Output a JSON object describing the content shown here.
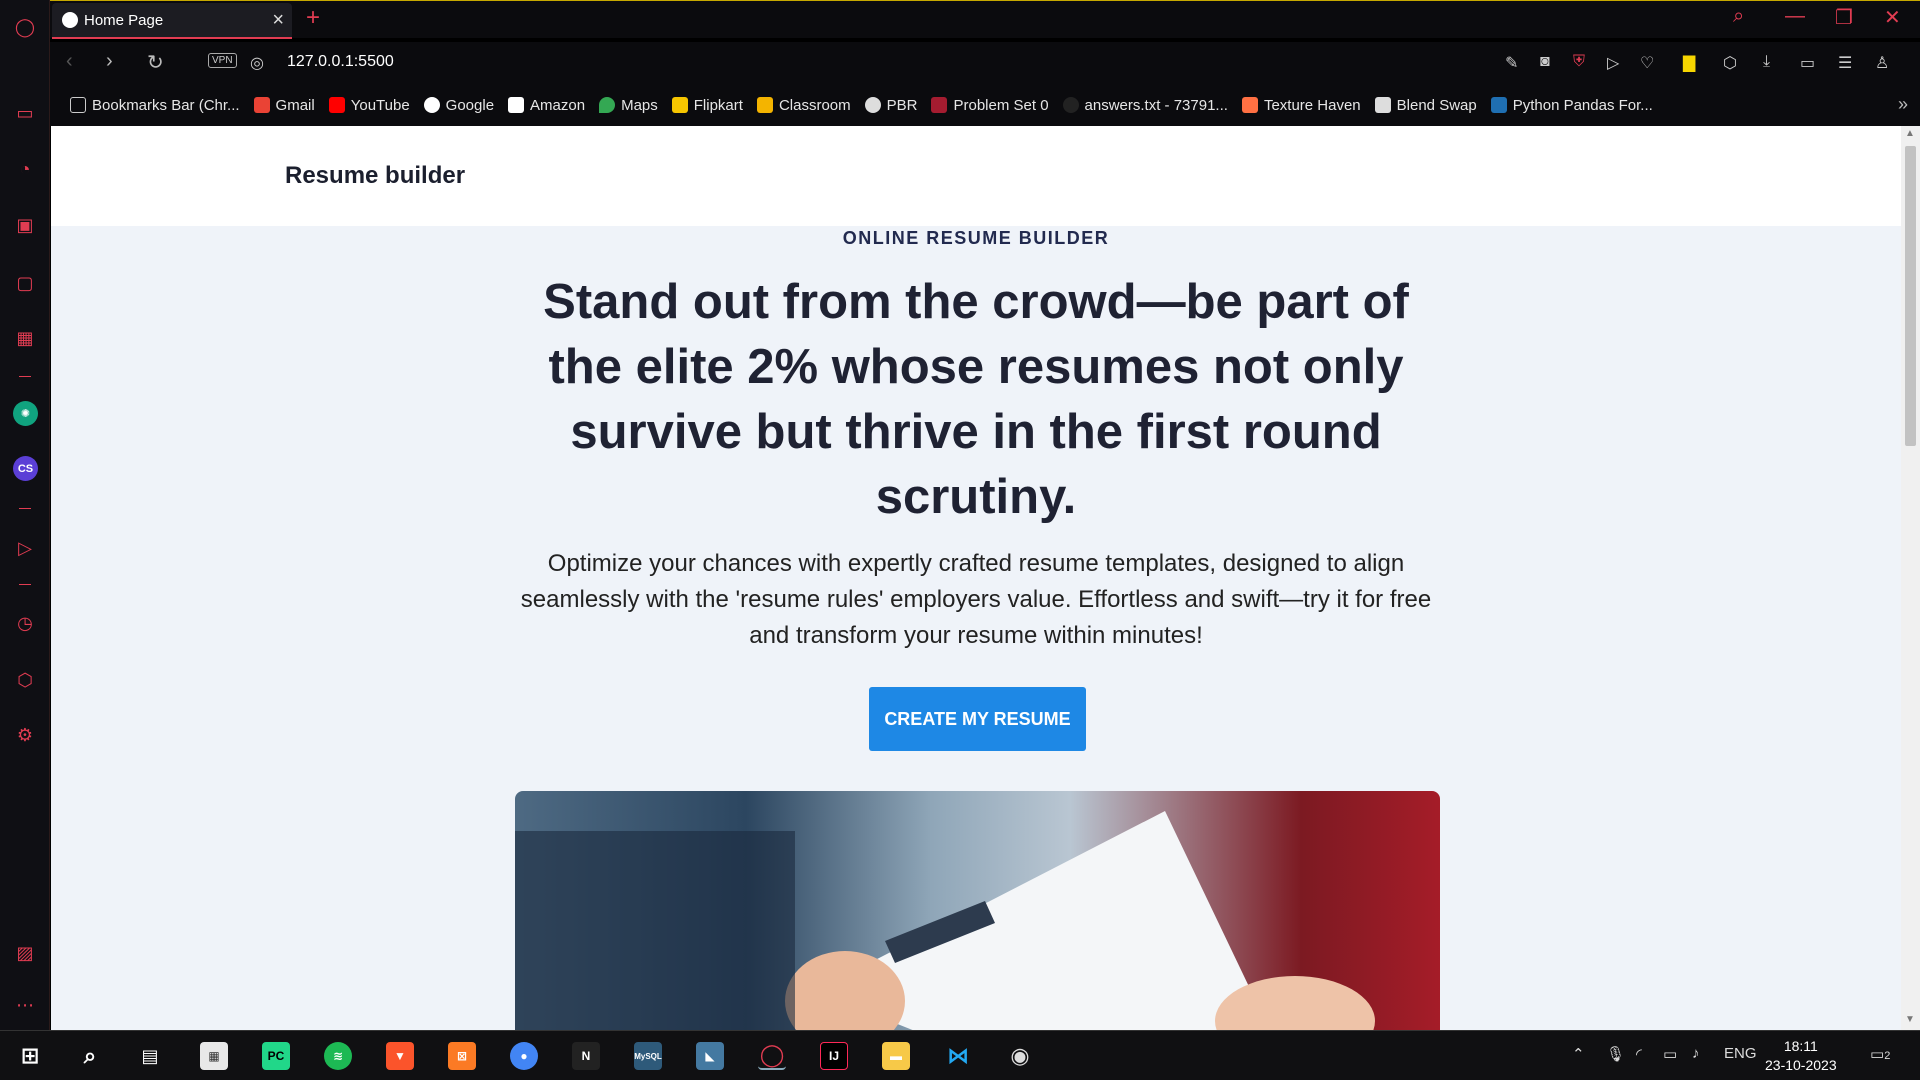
{
  "browser": {
    "tab_title": "Home Page",
    "url": "127.0.0.1:5500",
    "vpn_label": "VPN",
    "bookmarks": [
      {
        "label": "Bookmarks Bar (Chr...",
        "color": "#cccccc"
      },
      {
        "label": "Gmail",
        "color": "#ea4335"
      },
      {
        "label": "YouTube",
        "color": "#ff0000"
      },
      {
        "label": "Google",
        "color": "#4285f4"
      },
      {
        "label": "Amazon",
        "color": "#ffffff"
      },
      {
        "label": "Maps",
        "color": "#34a853"
      },
      {
        "label": "Flipkart",
        "color": "#f7c600"
      },
      {
        "label": "Classroom",
        "color": "#f4b400"
      },
      {
        "label": "PBR",
        "color": "#dddddd"
      },
      {
        "label": "Problem Set 0",
        "color": "#a51c30"
      },
      {
        "label": "answers.txt - 73791...",
        "color": "#555555"
      },
      {
        "label": "Texture Haven",
        "color": "#ff7043"
      },
      {
        "label": "Blend Swap",
        "color": "#dddddd"
      },
      {
        "label": "Python Pandas For...",
        "color": "#1f6fb2"
      }
    ]
  },
  "page": {
    "brand": "Resume builder",
    "eyebrow": "ONLINE RESUME BUILDER",
    "headline": "Stand out from the crowd—be part of the elite 2% whose resumes not only survive but thrive in the first round scrutiny.",
    "subtext": "Optimize your chances with expertly crafted resume templates, designed to align seamlessly with the 'resume rules' employers value. Effortless and swift—try it for free and transform your resume within minutes!",
    "cta_label": "CREATE MY RESUME",
    "accent_color": "#1e88e5"
  },
  "taskbar": {
    "language": "ENG",
    "time": "18:11",
    "date": "23-10-2023",
    "notification_count": "2"
  }
}
